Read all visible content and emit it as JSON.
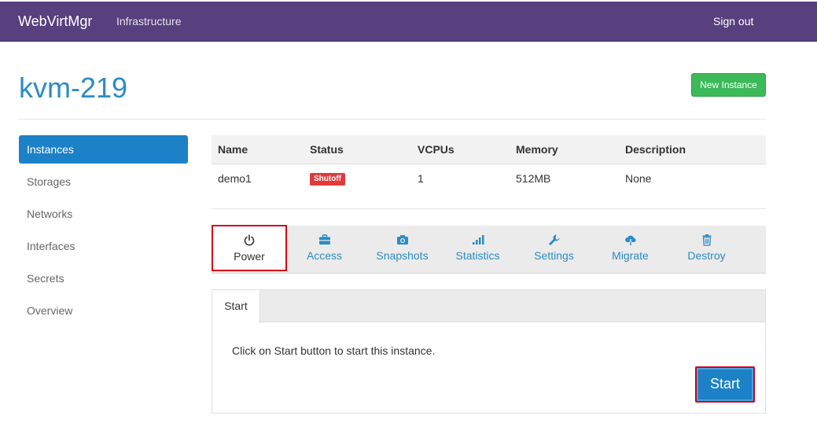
{
  "navbar": {
    "brand": "WebVirtMgr",
    "infrastructure": "Infrastructure",
    "sign_out": "Sign out"
  },
  "header": {
    "title": "kvm-219",
    "new_instance": "New Instance"
  },
  "sidebar": {
    "items": [
      {
        "label": "Instances",
        "active": true
      },
      {
        "label": "Storages"
      },
      {
        "label": "Networks"
      },
      {
        "label": "Interfaces"
      },
      {
        "label": "Secrets"
      },
      {
        "label": "Overview"
      }
    ]
  },
  "table": {
    "headers": [
      "Name",
      "Status",
      "VCPUs",
      "Memory",
      "Description"
    ],
    "rows": [
      {
        "name": "demo1",
        "status": "Shutoff",
        "vcpus": "1",
        "memory": "512MB",
        "description": "None"
      }
    ],
    "status_color": "#e03b3b"
  },
  "actions": [
    {
      "label": "Power",
      "icon": "power-icon",
      "active": true
    },
    {
      "label": "Access",
      "icon": "briefcase-icon"
    },
    {
      "label": "Snapshots",
      "icon": "camera-icon"
    },
    {
      "label": "Statistics",
      "icon": "signal-bars-icon"
    },
    {
      "label": "Settings",
      "icon": "wrench-icon"
    },
    {
      "label": "Migrate",
      "icon": "cloud-download-icon"
    },
    {
      "label": "Destroy",
      "icon": "trash-icon"
    }
  ],
  "power_panel": {
    "tab": "Start",
    "message": "Click on Start button to start this instance.",
    "start_button": "Start"
  },
  "colors": {
    "navbar": "#583f7e",
    "accent": "#2b8cc4",
    "primary_button": "#1c81c6",
    "success_button": "#3cb958"
  }
}
